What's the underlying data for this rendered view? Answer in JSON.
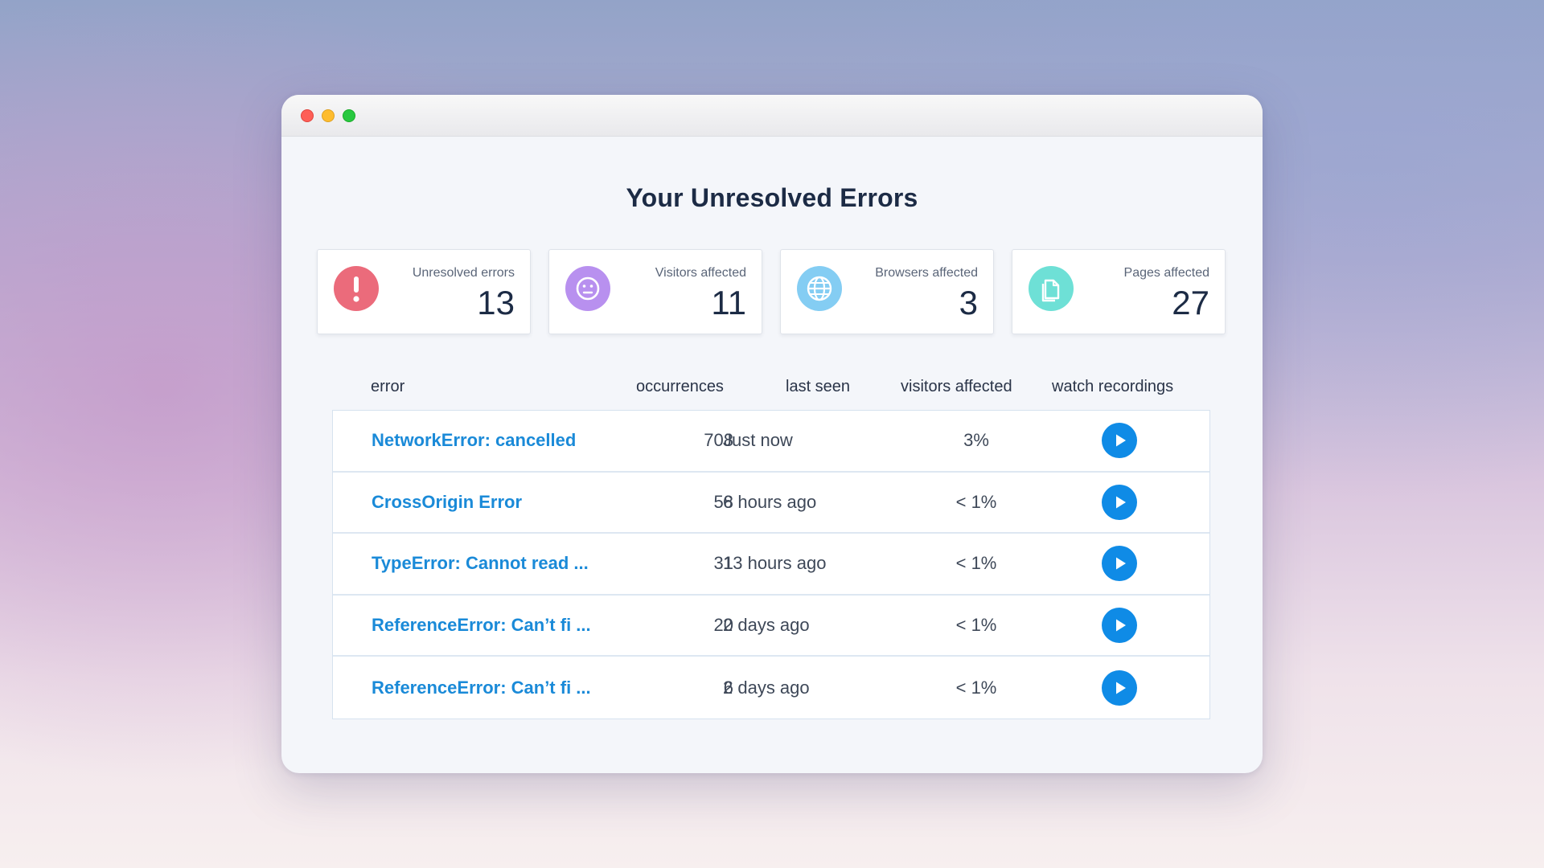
{
  "page": {
    "title": "Your Unresolved Errors"
  },
  "stats": [
    {
      "label": "Unresolved errors",
      "value": "13",
      "icon": "exclamation-icon",
      "color": "#eb6b7b"
    },
    {
      "label": "Visitors affected",
      "value": "11",
      "icon": "face-icon",
      "color": "#b890ef"
    },
    {
      "label": "Browsers affected",
      "value": "3",
      "icon": "globe-icon",
      "color": "#84cdf3"
    },
    {
      "label": "Pages affected",
      "value": "27",
      "icon": "pages-icon",
      "color": "#6ee0d6"
    }
  ],
  "table": {
    "columns": {
      "error": "error",
      "occurrences": "occurrences",
      "last_seen": "last seen",
      "visitors_affected": "visitors affected",
      "watch_recordings": "watch recordings"
    },
    "rows": [
      {
        "error": "NetworkError: cancelled",
        "occurrences": "708",
        "last_seen": "Just now",
        "visitors": "3%"
      },
      {
        "error": "CrossOrigin Error",
        "occurrences": "58",
        "last_seen": "6 hours ago",
        "visitors": "< 1%"
      },
      {
        "error": "TypeError: Cannot read ...",
        "occurrences": "31",
        "last_seen": "13 hours ago",
        "visitors": "< 1%"
      },
      {
        "error": "ReferenceError: Can’t fi ...",
        "occurrences": "20",
        "last_seen": "2 days ago",
        "visitors": "< 1%"
      },
      {
        "error": "ReferenceError: Can’t fi ...",
        "occurrences": "6",
        "last_seen": "2 days ago",
        "visitors": "< 1%"
      }
    ]
  },
  "colors": {
    "accent": "#1a8ad8",
    "play_button": "#0f8be6",
    "title": "#1c2b45"
  }
}
